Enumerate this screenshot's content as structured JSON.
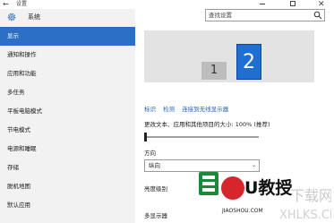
{
  "window": {
    "back_glyph": "←",
    "title": "设置",
    "close_glyph": "✕"
  },
  "sidebar": {
    "heading": "系统",
    "items": [
      {
        "label": "显示",
        "active": true
      },
      {
        "label": "通知和操作"
      },
      {
        "label": "应用和功能"
      },
      {
        "label": "多任务"
      },
      {
        "label": "平板电脑模式"
      },
      {
        "label": "节电模式"
      },
      {
        "label": "电源和睡眠"
      },
      {
        "label": "存储"
      },
      {
        "label": "脱机地图"
      },
      {
        "label": "默认应用"
      }
    ]
  },
  "search": {
    "placeholder": "查找设置"
  },
  "display": {
    "monitor_1": "1",
    "monitor_2": "2",
    "links": {
      "identify": "标识",
      "detect": "检测",
      "connect": "连接到无线显示器"
    },
    "scale_label": "更改文本、应用和其他项目的大小: 100% (推荐)",
    "scale_percent": 0,
    "orientation_label": "方向",
    "orientation_value": "纵向",
    "brightness_label": "亮度级别",
    "multiple_displays_label": "多显示器"
  },
  "watermark": {
    "brand": "U教授",
    "url": "JIAOSHOU.COM",
    "site_text": "XHLKS.CN",
    "side_text": "下载网"
  },
  "colors": {
    "accent": "#2b6fc6",
    "monitor_active": "#1f6fd2",
    "link": "#1f5fbf"
  }
}
